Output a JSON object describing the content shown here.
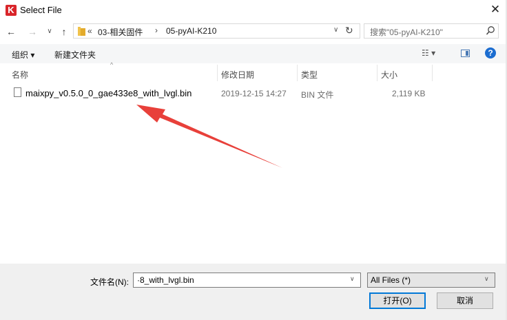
{
  "window": {
    "title": "Select File",
    "app_icon_letter": "K",
    "close_glyph": "✕"
  },
  "nav": {
    "back": "←",
    "forward": "→",
    "recent": "∨",
    "up": "↑"
  },
  "address": {
    "overflow": "«",
    "crumbs": [
      "03-相关固件",
      "05-pyAI-K210"
    ],
    "separator": "›",
    "dropdown": "∨",
    "refresh": "↻"
  },
  "search": {
    "placeholder": "搜索\"05-pyAI-K210\"",
    "icon": "search-icon"
  },
  "toolbar": {
    "organize": "组织 ▾",
    "new_folder": "新建文件夹",
    "view": "☷ ▾",
    "help": "?"
  },
  "columns": {
    "name": "名称",
    "date": "修改日期",
    "type": "类型",
    "size": "大小",
    "sort_indicator": "^"
  },
  "files": [
    {
      "name": "maixpy_v0.5.0_0_gae433e8_with_lvgl.bin",
      "date": "2019-12-15 14:27",
      "type": "BIN 文件",
      "size": "2,119 KB"
    }
  ],
  "footer": {
    "filename_label": "文件名(N):",
    "filename_value": "·8_with_lvgl.bin",
    "filetype_value": "All Files  (*)",
    "dropdown": "∨",
    "open_label": "打开(O)",
    "cancel_label": "取消"
  },
  "colors": {
    "annotation_arrow": "#e8403a",
    "accent": "#0078d7"
  }
}
